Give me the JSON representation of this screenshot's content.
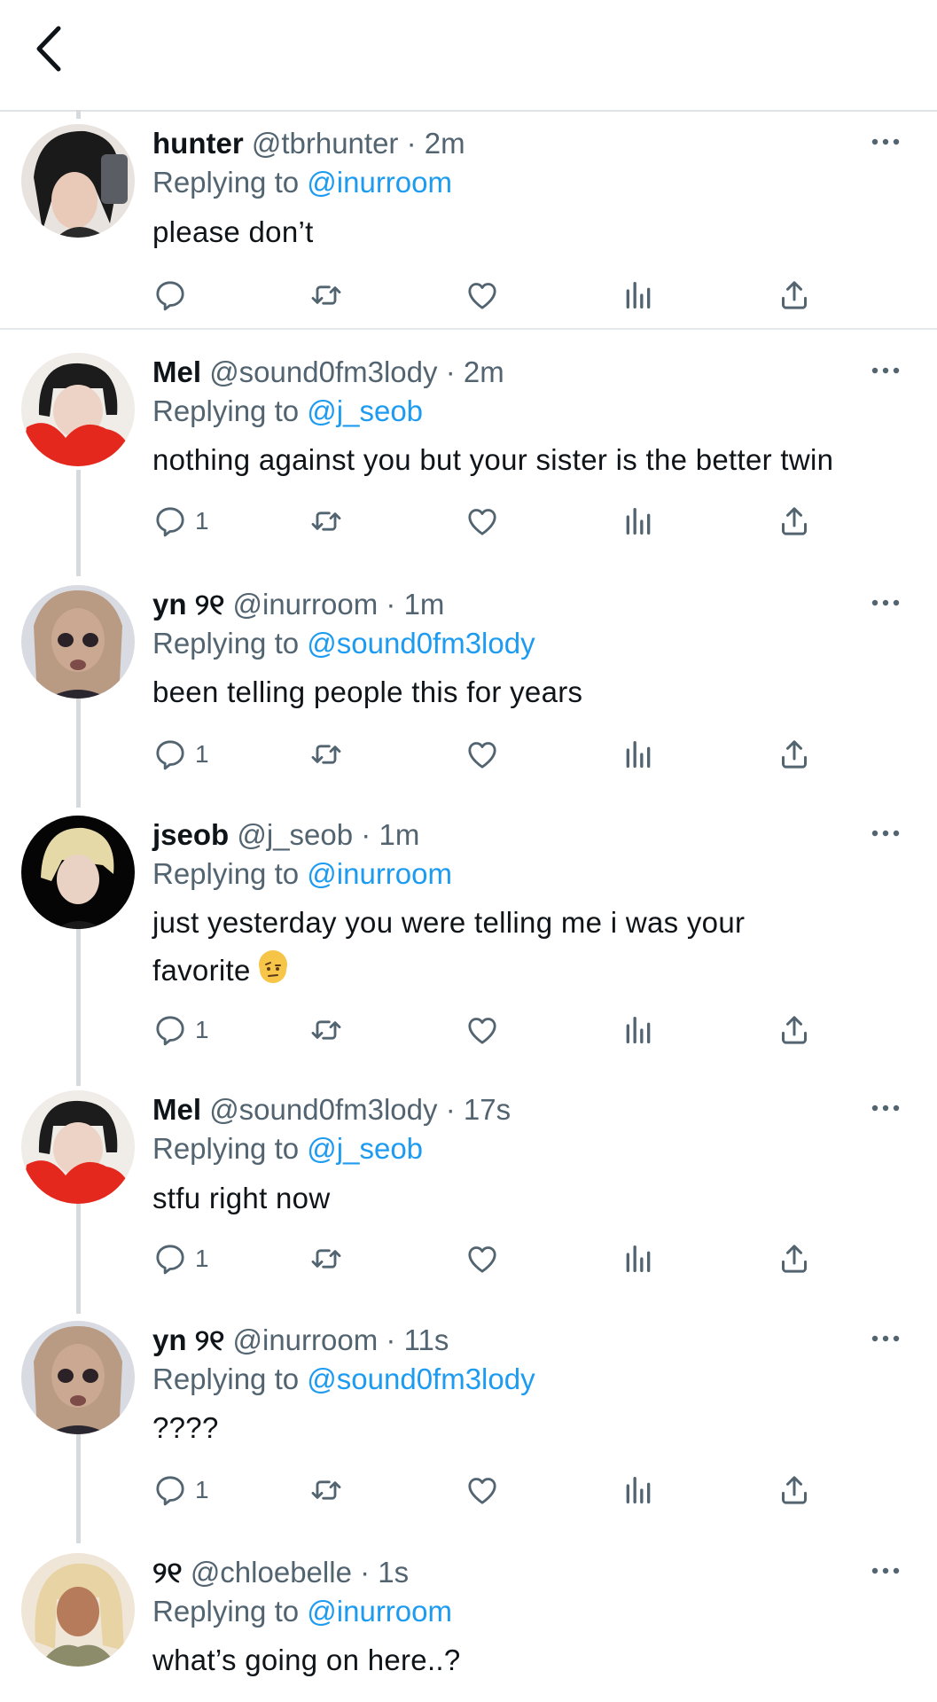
{
  "header": {
    "back_icon": "chevron-left-icon"
  },
  "colors": {
    "link": "#1d9bf0",
    "secondary_text": "#536471",
    "icon": "#536471",
    "divider": "#e6e9eb"
  },
  "icons": [
    "reply-icon",
    "retweet-icon",
    "like-icon",
    "views-icon",
    "share-icon",
    "more-icon"
  ],
  "tweets": [
    {
      "name": "hunter",
      "handle": "@tbrhunter",
      "time": "2m",
      "replying_prefix": "Replying to",
      "replying_to": "@inurroom",
      "text": "please don’t",
      "reply_count": ""
    },
    {
      "name": "Mel",
      "handle": "@sound0fm3lody",
      "time": "2m",
      "replying_prefix": "Replying to",
      "replying_to": "@j_seob",
      "text": "nothing against you but your sister is the better twin",
      "reply_count": "1"
    },
    {
      "name": "yn",
      "name_suffix": "୨୧",
      "handle": "@inurroom",
      "time": "1m",
      "replying_prefix": "Replying to",
      "replying_to": "@sound0fm3lody",
      "text": "been telling people this for years",
      "reply_count": "1"
    },
    {
      "name": "jseob",
      "handle": "@j_seob",
      "time": "1m",
      "replying_prefix": "Replying to",
      "replying_to": "@inurroom",
      "text_line1": "just yesterday you were telling me i was your",
      "text_line2": "favorite",
      "emoji": "face-with-raised-eyebrow",
      "reply_count": "1"
    },
    {
      "name": "Mel",
      "handle": "@sound0fm3lody",
      "time": "17s",
      "replying_prefix": "Replying to",
      "replying_to": "@j_seob",
      "text": "stfu right now",
      "reply_count": "1"
    },
    {
      "name": "yn",
      "name_suffix": "୨୧",
      "handle": "@inurroom",
      "time": "11s",
      "replying_prefix": "Replying to",
      "replying_to": "@sound0fm3lody",
      "text": "????",
      "reply_count": "1"
    },
    {
      "name": "୨୧",
      "handle": "@chloebelle",
      "time": "1s",
      "replying_prefix": "Replying to",
      "replying_to": "@inurroom",
      "text": "what’s going on here..?",
      "reply_count": ""
    }
  ]
}
